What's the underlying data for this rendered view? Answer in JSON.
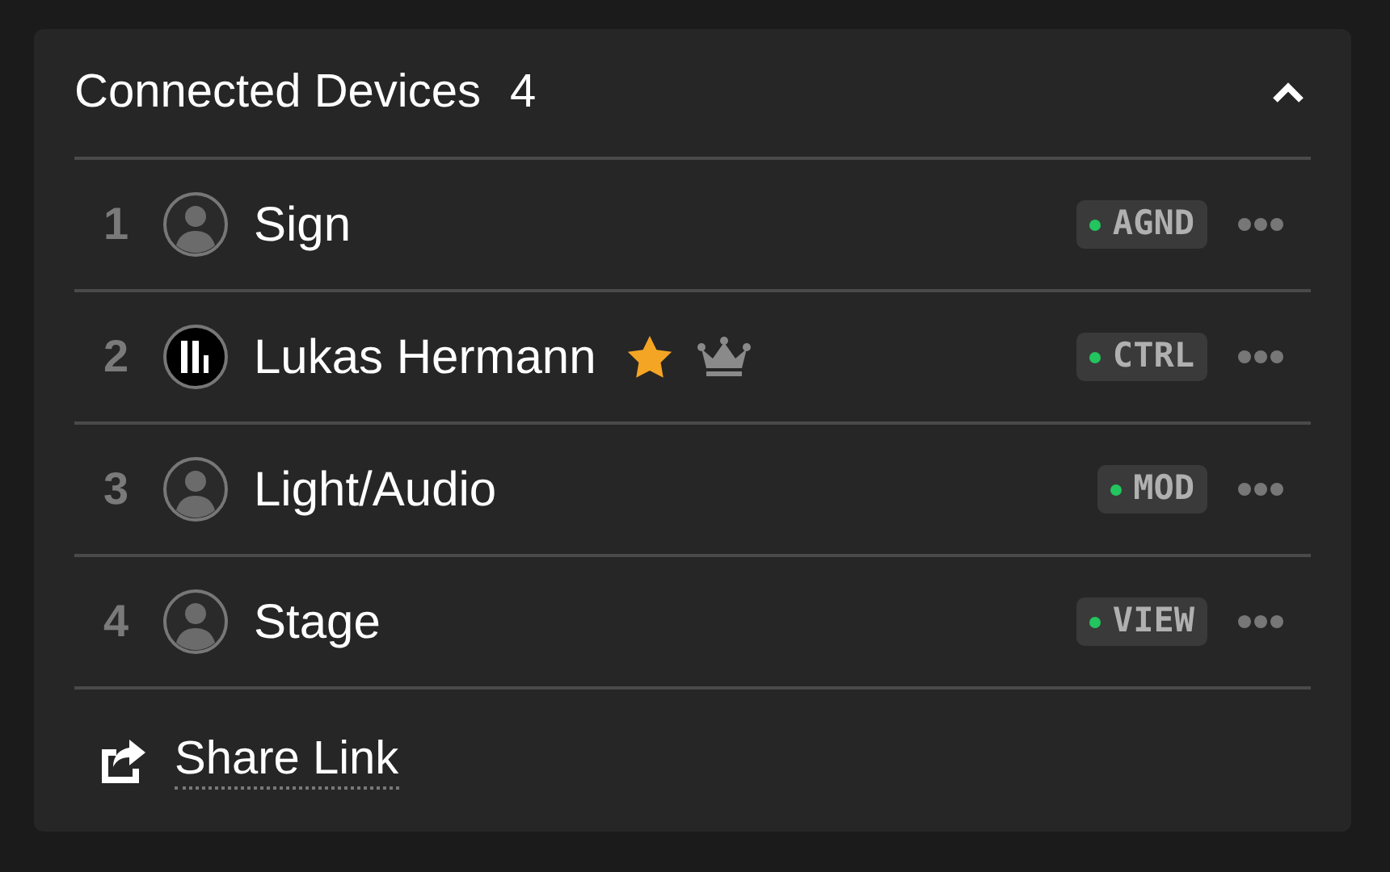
{
  "panel": {
    "title": "Connected Devices",
    "count": "4",
    "expanded": true
  },
  "devices": [
    {
      "index": "1",
      "kind": "person",
      "name": "Sign",
      "starred": false,
      "owner": false,
      "badge": "AGND",
      "color": "#22c55e"
    },
    {
      "index": "2",
      "kind": "logo",
      "name": "Lukas Hermann",
      "starred": true,
      "owner": true,
      "badge": "CTRL",
      "color": "#22c55e"
    },
    {
      "index": "3",
      "kind": "person",
      "name": "Light/Audio",
      "starred": false,
      "owner": false,
      "badge": "MOD",
      "color": "#22c55e"
    },
    {
      "index": "4",
      "kind": "person",
      "name": "Stage",
      "starred": false,
      "owner": false,
      "badge": "VIEW",
      "color": "#22c55e"
    }
  ],
  "share_link": "Share Link"
}
